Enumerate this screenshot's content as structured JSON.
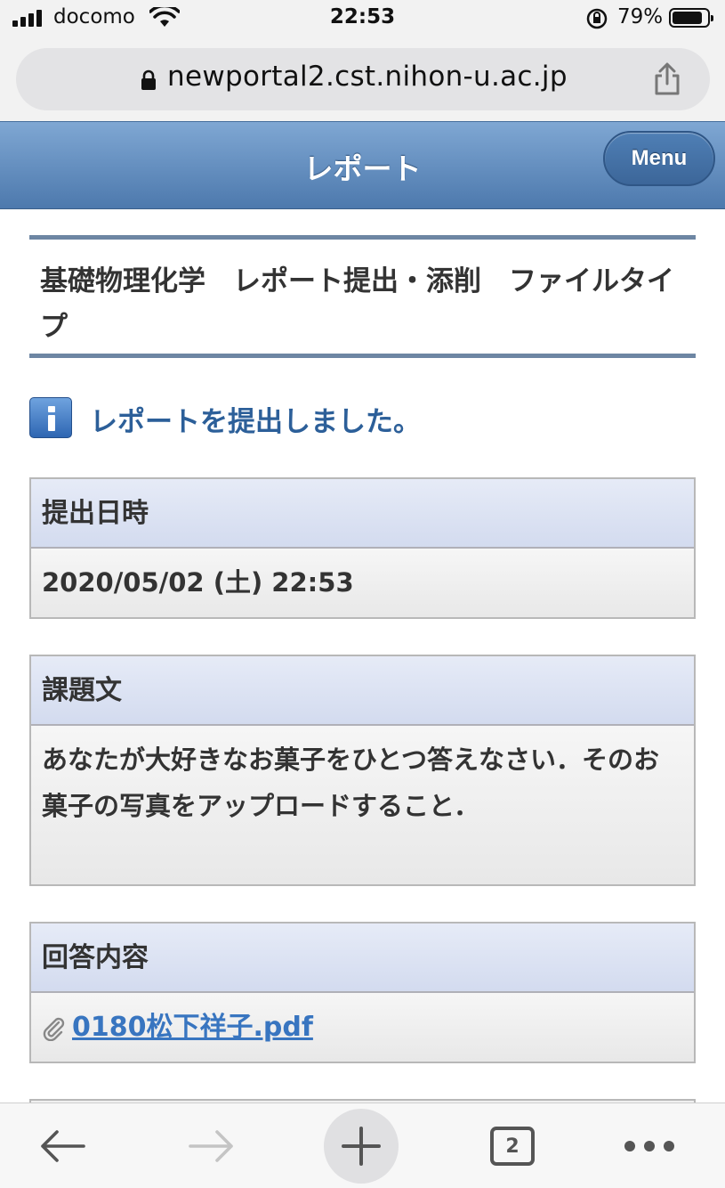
{
  "status_bar": {
    "carrier": "docomo",
    "time": "22:53",
    "battery_percent": "79%",
    "battery_level": 0.79
  },
  "browser": {
    "url": "newportal2.cst.nihon-u.ac.jp",
    "tab_count": "2"
  },
  "header": {
    "title": "レポート",
    "menu_label": "Menu"
  },
  "course": {
    "title": "基礎物理化学　レポート提出・添削　ファイルタイプ"
  },
  "notice": {
    "message": "レポートを提出しました。"
  },
  "submission": {
    "label": "提出日時",
    "value": "2020/05/02 (土) 22:53"
  },
  "assignment": {
    "label": "課題文",
    "text": "あなたが大好きなお菓子をひとつ答えなさい．そのお菓子の写真をアップロードすること．"
  },
  "answer": {
    "label": "回答内容",
    "file_name": "0180松下祥子.pdf"
  },
  "colors": {
    "header_gradient_top": "#7fa7d3",
    "header_gradient_bottom": "#4d79ad",
    "notice_text": "#2c5f99",
    "link": "#3875c0",
    "panel_head": "#dbe2f2"
  }
}
